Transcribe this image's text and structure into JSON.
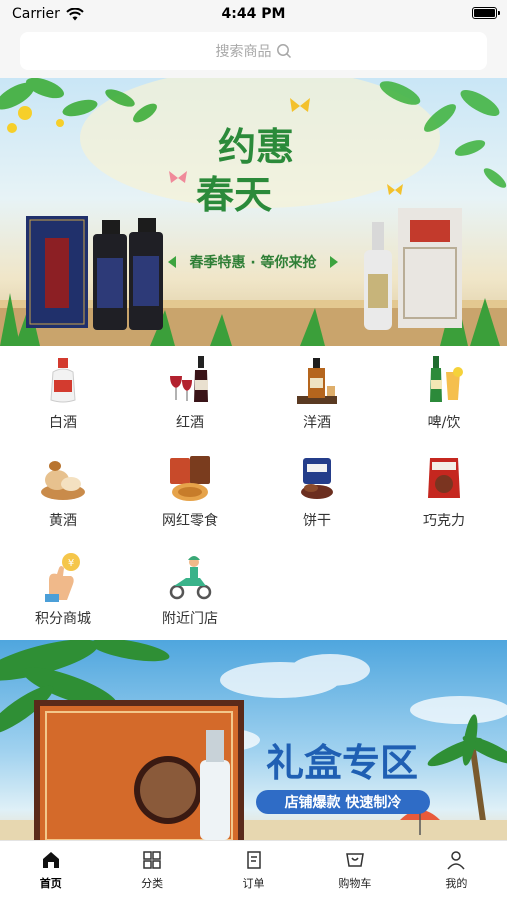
{
  "status_bar": {
    "carrier": "Carrier",
    "time": "4:44 PM"
  },
  "search": {
    "placeholder": "搜索商品"
  },
  "banner_top": {
    "title_line1": "约惠",
    "title_line2": "春天",
    "slogan": "春季特惠 · 等你来抢"
  },
  "categories": [
    {
      "label": "白酒",
      "icon": "baijiu-bottle-icon"
    },
    {
      "label": "红酒",
      "icon": "red-wine-icon"
    },
    {
      "label": "洋酒",
      "icon": "whisky-icon"
    },
    {
      "label": "啤/饮",
      "icon": "beer-drink-icon"
    },
    {
      "label": "黄酒",
      "icon": "huangjiu-icon"
    },
    {
      "label": "网红零食",
      "icon": "snack-icon"
    },
    {
      "label": "饼干",
      "icon": "biscuit-icon"
    },
    {
      "label": "巧克力",
      "icon": "chocolate-icon"
    },
    {
      "label": "积分商城",
      "icon": "points-mall-icon"
    },
    {
      "label": "附近门店",
      "icon": "nearby-store-icon"
    }
  ],
  "banner_bottom": {
    "title": "礼盒专区",
    "tagline": "店铺爆款  快速制冷"
  },
  "tabbar": [
    {
      "label": "首页",
      "icon": "home-icon",
      "active": true
    },
    {
      "label": "分类",
      "icon": "category-grid-icon",
      "active": false
    },
    {
      "label": "订单",
      "icon": "order-icon",
      "active": false
    },
    {
      "label": "购物车",
      "icon": "cart-icon",
      "active": false
    },
    {
      "label": "我的",
      "icon": "profile-icon",
      "active": false
    }
  ]
}
